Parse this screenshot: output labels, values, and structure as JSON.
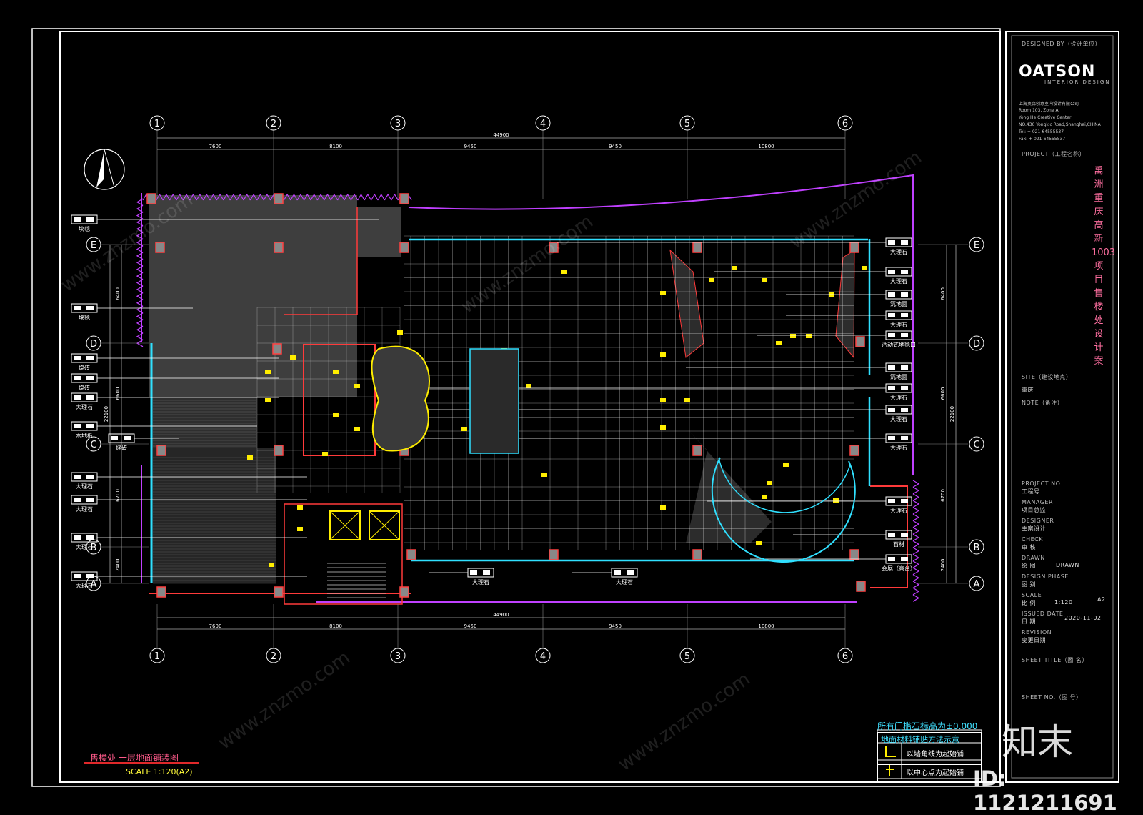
{
  "drawing": {
    "title": "售楼处 一层地面铺装图",
    "scale": "SCALE 1:120(A2)",
    "grid_columns": [
      "1",
      "2",
      "3",
      "4",
      "5",
      "6"
    ],
    "grid_rows": [
      "E",
      "D",
      "C",
      "B",
      "A"
    ],
    "dims_top": [
      "7600",
      "8100",
      "9450",
      "9450",
      "10800"
    ],
    "dims_total": "44900",
    "dims_left": [
      "6400",
      "6600",
      "6700",
      "2400"
    ],
    "dims_left_total": "22100",
    "dims_right": [
      "6400",
      "6600",
      "6700",
      "2400"
    ],
    "dims_right_total": "22100"
  },
  "left_callouts": [
    "块毯",
    "块毯",
    "烧砖",
    "烧砖",
    "大理石",
    "木地板",
    "烧砖",
    "大理石",
    "大理石",
    "大理石",
    "大理石"
  ],
  "right_callouts": [
    "大理石",
    "大理石",
    "沉地面",
    "大理石",
    "活动式地毯口",
    "沉地面",
    "大理石",
    "大理石",
    "大理石",
    "大理石",
    "石材",
    "会展（高台）"
  ],
  "bottom_callouts": [
    "大理石",
    "大理石"
  ],
  "title_block": {
    "designed_by": "DESIGNED BY（设计单位）",
    "logo": "OATSON",
    "logo_sub": "INTERIOR DESIGN",
    "address": [
      "上海奥森创意室内设计有限公司",
      "Room 103, Zone A,",
      "Yong He Creative Center,",
      "NO.436 Yongkic Road,Shanghai,CHINA",
      "Tel: + 021-64555537",
      "Fax: + 021-64555537"
    ],
    "project_label": "PROJECT（工程名称）",
    "project_name": "禹洲重庆高新1003项目 售楼处设计案",
    "site_label": "SITE（建设地点）",
    "site_value": "重庆",
    "note_label": "NOTE（备注）",
    "project_no_label": "PROJECT NO.",
    "project_no_cn": "工程号",
    "manager_label": "MANAGER",
    "manager_cn": "项目总监",
    "designer_label": "DESIGNER",
    "designer_cn": "主案设计",
    "check_label": "CHECK",
    "check_cn": "审 核",
    "drawn_label": "DRAWN",
    "drawn_cn": "绘 图",
    "drawn_val": "DRAWN",
    "phase_label": "DESIGN PHASE",
    "phase_cn": "图 别",
    "scale_label": "SCALE",
    "scale_cn": "比 例",
    "scale_val": "1:120",
    "paper": "A2",
    "issued_label": "ISSUED DATE",
    "issued_cn": "日 期",
    "issued_val": "2020-11-02",
    "revision_label": "REVISION",
    "revision_cn": "变更日期",
    "sheet_title_label": "SHEET TITLE（图 名）",
    "sheet_no_label": "SHEET NO.（图 号）"
  },
  "legend": {
    "note": "所有门槛石标高为±0.000",
    "title": "地面材料铺贴方法示意",
    "row1": "以墙角线为起始铺",
    "row2": "以中心点为起始铺"
  },
  "watermark": {
    "brand": "知末",
    "id": "ID: 1121211691",
    "url": "www.znzmo.com"
  },
  "colors": {
    "wall": "#ff3a3a",
    "boundary": "#c040ff",
    "glass": "#30e0ff",
    "grid": "#ffffff",
    "column": "#ff4040",
    "marker": "#ffee00"
  }
}
